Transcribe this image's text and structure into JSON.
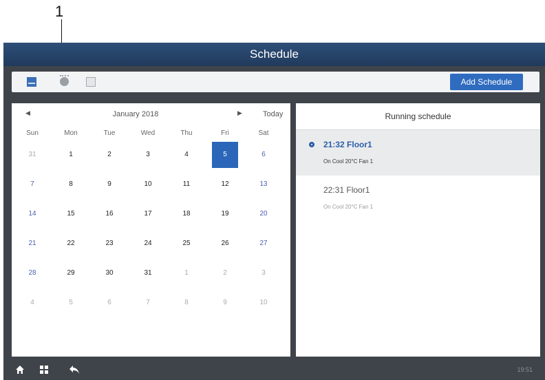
{
  "annotation": {
    "callout_number": "1"
  },
  "header": {
    "title": "Schedule"
  },
  "toolbar": {
    "icons": [
      "calendar-view-icon",
      "timer-icon",
      "list-view-icon"
    ],
    "add_button_label": "Add Schedule"
  },
  "calendar": {
    "month_label": "January 2018",
    "today_label": "Today",
    "weekdays": [
      "Sun",
      "Mon",
      "Tue",
      "Wed",
      "Thu",
      "Fri",
      "Sat"
    ],
    "weeks": [
      [
        "31",
        "1",
        "2",
        "3",
        "4",
        "5",
        "6"
      ],
      [
        "7",
        "8",
        "9",
        "10",
        "11",
        "12",
        "13"
      ],
      [
        "14",
        "15",
        "16",
        "17",
        "18",
        "19",
        "20"
      ],
      [
        "21",
        "22",
        "23",
        "24",
        "25",
        "26",
        "27"
      ],
      [
        "28",
        "29",
        "30",
        "31",
        "1",
        "2",
        "3"
      ],
      [
        "4",
        "5",
        "6",
        "7",
        "8",
        "9",
        "10"
      ]
    ],
    "selected_day": "5",
    "colors": {
      "selected": "#2b66b8",
      "weekend": "#4a5fb0",
      "outside_month": "#aaaaaa"
    }
  },
  "running": {
    "title": "Running schedule",
    "items": [
      {
        "title": "21:32 Floor1",
        "detail": "On Cool 20°C Fan 1",
        "active": true
      },
      {
        "title": "22:31 Floor1",
        "detail": "On Cool 20°C Fan 1",
        "active": false
      }
    ]
  },
  "bottom_bar": {
    "icons": [
      "home-icon",
      "menu-grid-icon",
      "back-icon"
    ],
    "time": "19:51"
  },
  "colors": {
    "title_bar": "#2a4a72",
    "accent": "#2f6cbf",
    "frame": "#3f444a"
  }
}
